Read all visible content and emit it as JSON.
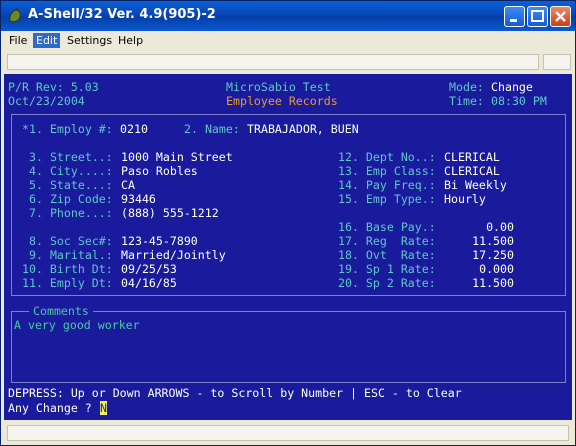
{
  "window": {
    "title": "A-Shell/32 Ver. 4.9(905)-2"
  },
  "menu": {
    "items": [
      "File",
      "Edit",
      "Settings",
      "Help"
    ]
  },
  "header": {
    "rev": "P/R Rev: 5.03",
    "date": "Oct/23/2004",
    "company": "MicroSabio Test",
    "screen_title": "Employee Records",
    "mode_label": "Mode:",
    "mode_value": "Change",
    "time_label": "Time:",
    "time_value": "08:30 PM"
  },
  "fields": {
    "f1_label": "*1. Employ #:",
    "f1_value": "0210",
    "f2_label": "2. Name:",
    "f2_value": "TRABAJADOR, BUEN",
    "f3_label": "3. Street..:",
    "f3_value": "1000 Main Street",
    "f4_label": "4. City....:",
    "f4_value": "Paso Robles",
    "f5_label": "5. State...:",
    "f5_value": "CA",
    "f6_label": "6. Zip Code:",
    "f6_value": "93446",
    "f7_label": "7. Phone...:",
    "f7_value": "(888) 555-1212",
    "f8_label": "8. Soc Sec#:",
    "f8_value": "123-45-7890",
    "f9_label": "9. Marital.:",
    "f9_value": "Married/Jointly",
    "f10_label": "10. Birth Dt:",
    "f10_value": "09/25/53",
    "f11_label": "11. Emply Dt:",
    "f11_value": "04/16/85",
    "f12_label": "12. Dept No..:",
    "f12_value": "CLERICAL",
    "f13_label": "13. Emp Class:",
    "f13_value": "CLERICAL",
    "f14_label": "14. Pay Freq.:",
    "f14_value": "Bi Weekly",
    "f15_label": "15. Emp Type.:",
    "f15_value": "Hourly",
    "f16_label": "16. Base Pay.:",
    "f16_value": "0.00",
    "f17_label": "17. Reg  Rate:",
    "f17_value": "11.500",
    "f18_label": "18. Ovt  Rate:",
    "f18_value": "17.250",
    "f19_label": "19. Sp 1 Rate:",
    "f19_value": "0.000",
    "f20_label": "20. Sp 2 Rate:",
    "f20_value": "11.500"
  },
  "comments": {
    "label": "Comments",
    "text": "A very good worker"
  },
  "prompt": {
    "help_line": "DEPRESS: Up or Down ARROWS - to Scroll by Number | ESC - to Clear",
    "question": "Any Change ?",
    "answer": "N"
  },
  "colors": {
    "screen_bg": "#1a1a9c",
    "label": "#5ec8c8",
    "value": "#ffffff",
    "accent": "#e89a30"
  }
}
